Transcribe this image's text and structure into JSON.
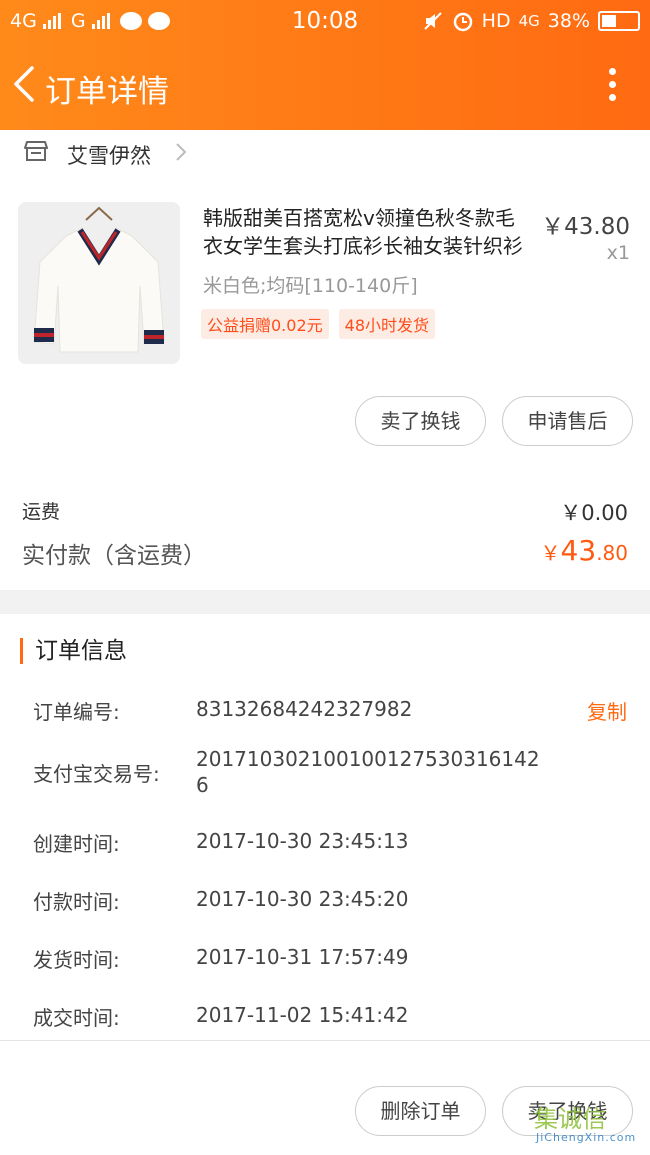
{
  "status_bar": {
    "network1": "4G",
    "network2": "G",
    "time": "10:08",
    "hd": "HD",
    "network3": "4G",
    "battery": "38%"
  },
  "nav": {
    "title": "订单详情"
  },
  "shop": {
    "name": "艾雪伊然"
  },
  "product": {
    "title": "韩版甜美百搭宽松v领撞色秋冬款毛衣女学生套头打底衫长袖女装针织衫",
    "price": "￥43.80",
    "qty": "x1",
    "sku": "米白色;均码[110-140斤]",
    "tags": [
      "公益捐赠0.02元",
      "48小时发货"
    ]
  },
  "item_actions": {
    "sell_label": "卖了换钱",
    "aftersale_label": "申请售后"
  },
  "payment": {
    "freight_label": "运费",
    "freight_value": "￥0.00",
    "paid_label": "实付款（含运费）",
    "paid_currency": "￥",
    "paid_int": "43",
    "paid_dec": ".80"
  },
  "order_info": {
    "section_title": "订单信息",
    "copy_label": "复制",
    "rows": [
      {
        "label": "订单编号:",
        "value": "83132684242327982"
      },
      {
        "label": "支付宝交易号:",
        "value": "2017103021001001275303161426"
      },
      {
        "label": "创建时间:",
        "value": "2017-10-30 23:45:13"
      },
      {
        "label": "付款时间:",
        "value": "2017-10-30 23:45:20"
      },
      {
        "label": "发货时间:",
        "value": "2017-10-31 17:57:49"
      },
      {
        "label": "成交时间:",
        "value": "2017-11-02 15:41:42"
      }
    ]
  },
  "bottom_actions": {
    "delete_label": "删除订单",
    "sell_label": "卖了换钱"
  },
  "watermark": {
    "main": "集诚信",
    "sub": "JiChengXin.com"
  },
  "colors": {
    "brand_orange": "#ff6a12",
    "price_orange": "#ff5a10",
    "tag_bg": "#fdece4"
  }
}
